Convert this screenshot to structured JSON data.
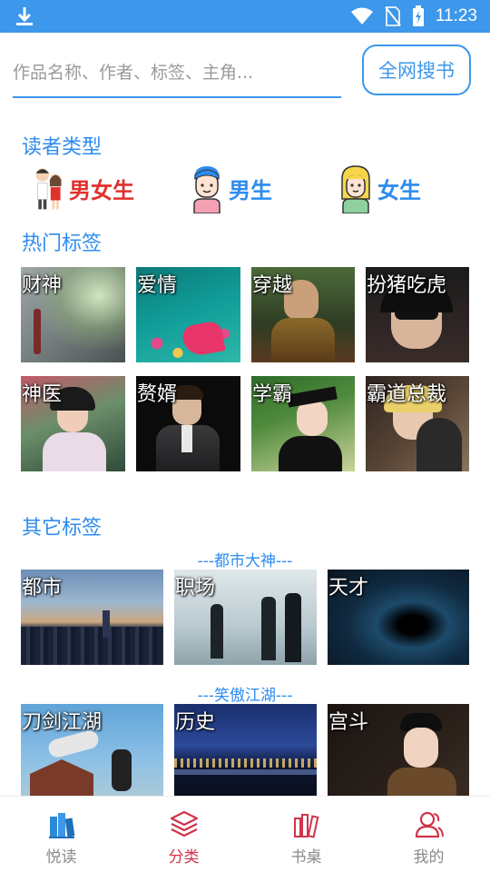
{
  "status_bar": {
    "time": "11:23"
  },
  "search": {
    "placeholder": "作品名称、作者、标签、主角...",
    "button": "全网搜书"
  },
  "reader_types": {
    "title": "读者类型",
    "items": [
      {
        "label": "男女生",
        "color": "#e0312d",
        "icon": "boy-girl-icon"
      },
      {
        "label": "男生",
        "color": "#2d8cf0",
        "icon": "boy-icon"
      },
      {
        "label": "女生",
        "color": "#2d8cf0",
        "icon": "girl-icon"
      }
    ]
  },
  "hot_tags": {
    "title": "热门标签",
    "items": [
      {
        "label": "财神"
      },
      {
        "label": "爱情"
      },
      {
        "label": "穿越"
      },
      {
        "label": "扮猪吃虎"
      },
      {
        "label": "神医"
      },
      {
        "label": "赘婿"
      },
      {
        "label": "学霸"
      },
      {
        "label": "霸道总裁"
      }
    ]
  },
  "other_tags": {
    "title": "其它标签",
    "groups": [
      {
        "subtitle": "---都市大神---",
        "items": [
          {
            "label": "都市"
          },
          {
            "label": "职场"
          },
          {
            "label": "天才"
          }
        ]
      },
      {
        "subtitle": "---笑傲江湖---",
        "items": [
          {
            "label": "刀剑江湖"
          },
          {
            "label": "历史"
          },
          {
            "label": "宫斗"
          }
        ]
      }
    ]
  },
  "bottom_nav": {
    "items": [
      {
        "label": "悦读",
        "icon": "books-icon"
      },
      {
        "label": "分类",
        "icon": "layers-icon",
        "active": true
      },
      {
        "label": "书桌",
        "icon": "bookshelf-icon"
      },
      {
        "label": "我的",
        "icon": "user-icon"
      }
    ]
  },
  "colors": {
    "accent": "#3d97ea",
    "active_tab": "#d0334a"
  }
}
